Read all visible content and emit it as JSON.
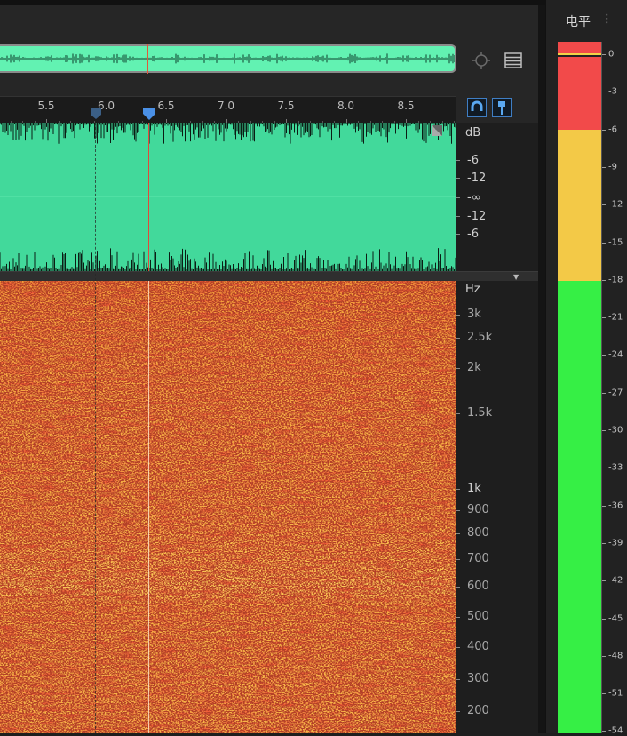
{
  "overview": {
    "playhead_position_s": 6.35
  },
  "ruler": {
    "labels": [
      "5.5",
      "6.0",
      "6.5",
      "7.0",
      "7.5",
      "8.0",
      "8.5"
    ],
    "values": [
      5.5,
      6.0,
      6.5,
      7.0,
      7.5,
      8.0,
      8.5
    ]
  },
  "markers": {
    "cursor_time_s": 6.35,
    "selection_marker_time_s": 5.91
  },
  "toolbar": {
    "zoom_icon": "zoom-target-icon",
    "list_icon": "list-view-icon",
    "snap_icon": "magnet-snap-icon",
    "marker_icon": "pin-marker-icon"
  },
  "db_scale": {
    "unit": "dB",
    "labels": [
      "-6",
      "-12",
      "-∞",
      "-12",
      "-6"
    ]
  },
  "hz_scale": {
    "unit": "Hz",
    "labels": [
      "3k",
      "2.5k",
      "2k",
      "1.5k",
      "1k",
      "900",
      "800",
      "700",
      "600",
      "500",
      "400",
      "300",
      "200"
    ]
  },
  "level_meter": {
    "title": "电平",
    "menu_icon": "panel-menu-icon",
    "scale": [
      "0",
      "-3",
      "-6",
      "-9",
      "-12",
      "-15",
      "-18",
      "-21",
      "-24",
      "-27",
      "-30",
      "-33",
      "-36",
      "-39",
      "-42",
      "-45",
      "-48",
      "-51",
      "-54"
    ],
    "peak_hold_db": 0,
    "colors": {
      "clip": "#f24a4a",
      "warn": "#f3c947",
      "ok": "#36ef45"
    }
  },
  "colors": {
    "waveform_bg": "#42d99b",
    "overview_bg": "#62f2b2",
    "playhead": "#e24a3b",
    "accent": "#3f7ec4",
    "spectrogram_base": "#f4a93e"
  }
}
